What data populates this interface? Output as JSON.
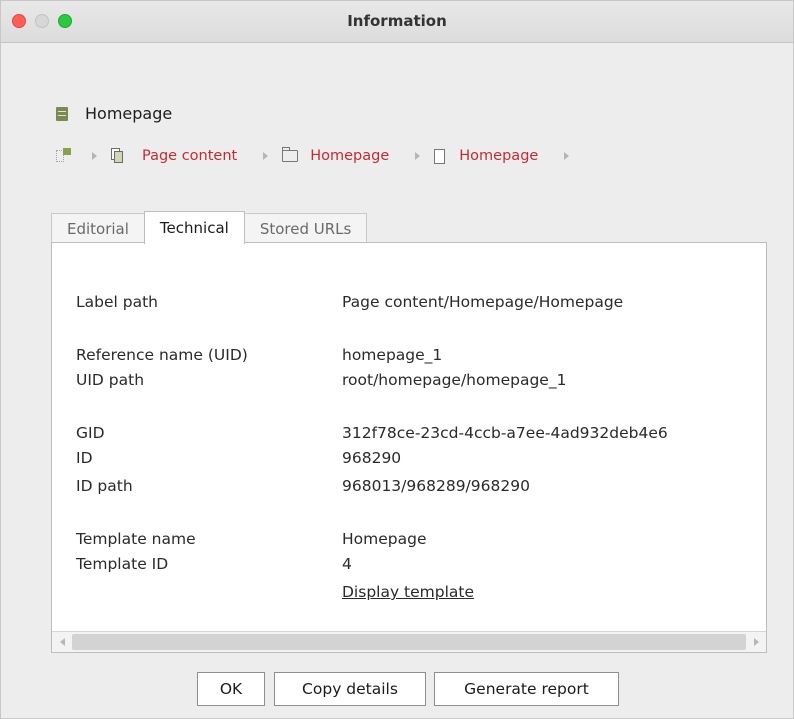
{
  "window": {
    "title": "Information"
  },
  "header": {
    "title": "Homepage"
  },
  "breadcrumb": {
    "items": [
      {
        "label": "Page content"
      },
      {
        "label": "Homepage"
      },
      {
        "label": "Homepage"
      }
    ]
  },
  "tabs": [
    {
      "label": "Editorial"
    },
    {
      "label": "Technical",
      "active": true
    },
    {
      "label": "Stored URLs"
    }
  ],
  "details": {
    "label_path": {
      "label": "Label path",
      "value": "Page content/Homepage/Homepage"
    },
    "reference_name": {
      "label": "Reference name (UID)",
      "value": "homepage_1"
    },
    "uid_path": {
      "label": "UID path",
      "value": "root/homepage/homepage_1"
    },
    "gid": {
      "label": "GID",
      "value": "312f78ce-23cd-4ccb-a7ee-4ad932deb4e6"
    },
    "id": {
      "label": "ID",
      "value": "968290"
    },
    "id_path": {
      "label": "ID path",
      "value": "968013/968289/968290"
    },
    "template_name": {
      "label": "Template name",
      "value": "Homepage"
    },
    "template_id": {
      "label": "Template ID",
      "value": "4"
    },
    "display_template": "Display template"
  },
  "buttons": {
    "ok": "OK",
    "copy_details": "Copy details",
    "generate_report": "Generate report"
  },
  "colors": {
    "link_red": "#c52a33",
    "close": "#fe5f57",
    "maximize": "#2bc840"
  }
}
